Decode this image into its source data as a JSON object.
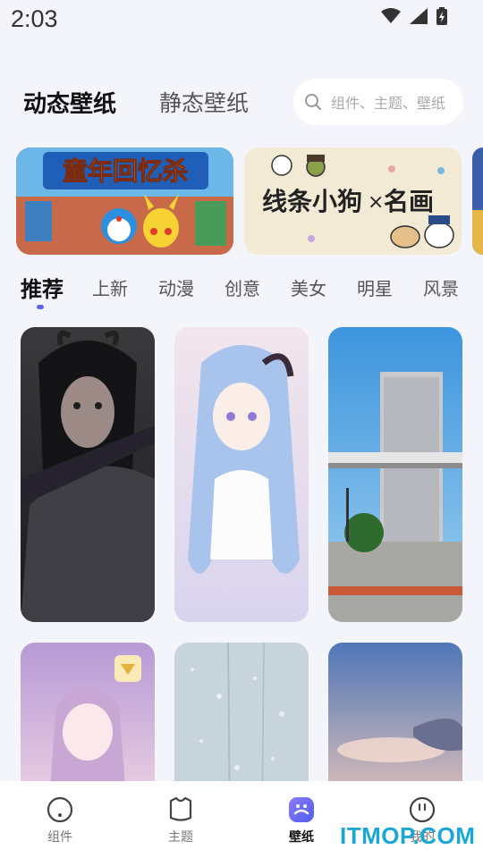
{
  "status": {
    "time": "2:03"
  },
  "header": {
    "tabs": [
      {
        "label": "动态壁纸"
      },
      {
        "label": "静态壁纸"
      }
    ],
    "search_placeholder": "组件、主题、壁纸"
  },
  "banners": [
    {
      "title": "童年回忆杀"
    },
    {
      "title_part1": "线条小狗",
      "title_sep": "×",
      "title_part2": "名画"
    }
  ],
  "categories": [
    {
      "label": "推荐"
    },
    {
      "label": "上新"
    },
    {
      "label": "动漫"
    },
    {
      "label": "创意"
    },
    {
      "label": "美女"
    },
    {
      "label": "明星"
    },
    {
      "label": "风景"
    }
  ],
  "bottom_nav": [
    {
      "label": "组件",
      "icon": "widget-icon"
    },
    {
      "label": "主题",
      "icon": "shirt-icon"
    },
    {
      "label": "壁纸",
      "icon": "wallpaper-icon"
    },
    {
      "label": "我的",
      "icon": "profile-icon"
    }
  ],
  "watermark": "ITMOP.COM",
  "colors": {
    "accent": "#5b63f5",
    "background": "#f4f5fb"
  }
}
